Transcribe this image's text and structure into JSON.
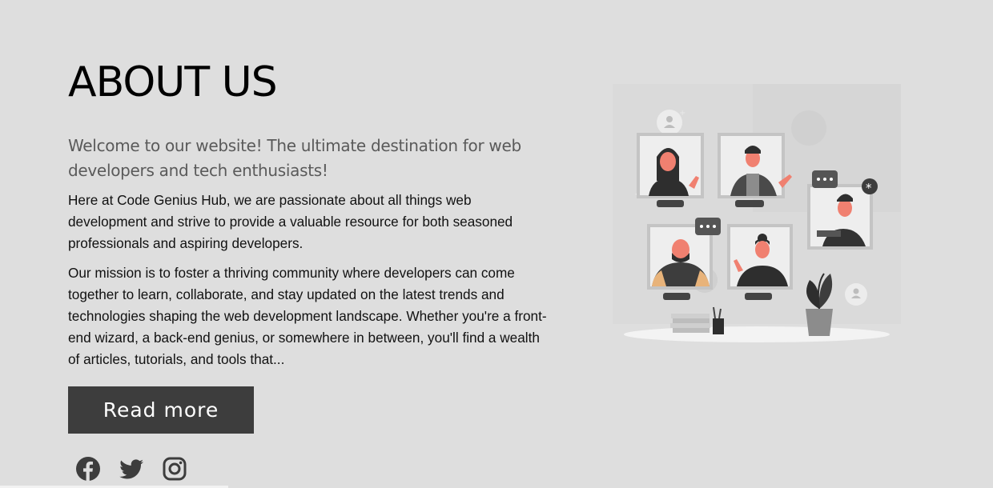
{
  "about": {
    "title": "ABOUT US",
    "subtitle": "Welcome to our website! The ultimate destination for web developers and tech enthusiasts!",
    "paragraph1": "Here at Code Genius Hub, we are passionate about all things web development and strive to provide a valuable resource for both seasoned professionals and aspiring developers.",
    "paragraph2": "Our mission is to foster a thriving community where developers can come together to learn, collaborate, and stay updated on the latest trends and technologies shaping the web development landscape. Whether you're a front-end wizard, a back-end genius, or somewhere in between, you'll find a wealth of articles, tutorials, and tools that...",
    "read_more_label": "Read more"
  },
  "social": {
    "icons": [
      "facebook-icon",
      "twitter-icon",
      "instagram-icon"
    ]
  },
  "colors": {
    "background": "#dedede",
    "button": "#3d3d3d",
    "subtitle": "#5a5a5a",
    "accent_skin": "#f08070"
  },
  "illustration": {
    "subject": "team-video-call-illustration"
  }
}
